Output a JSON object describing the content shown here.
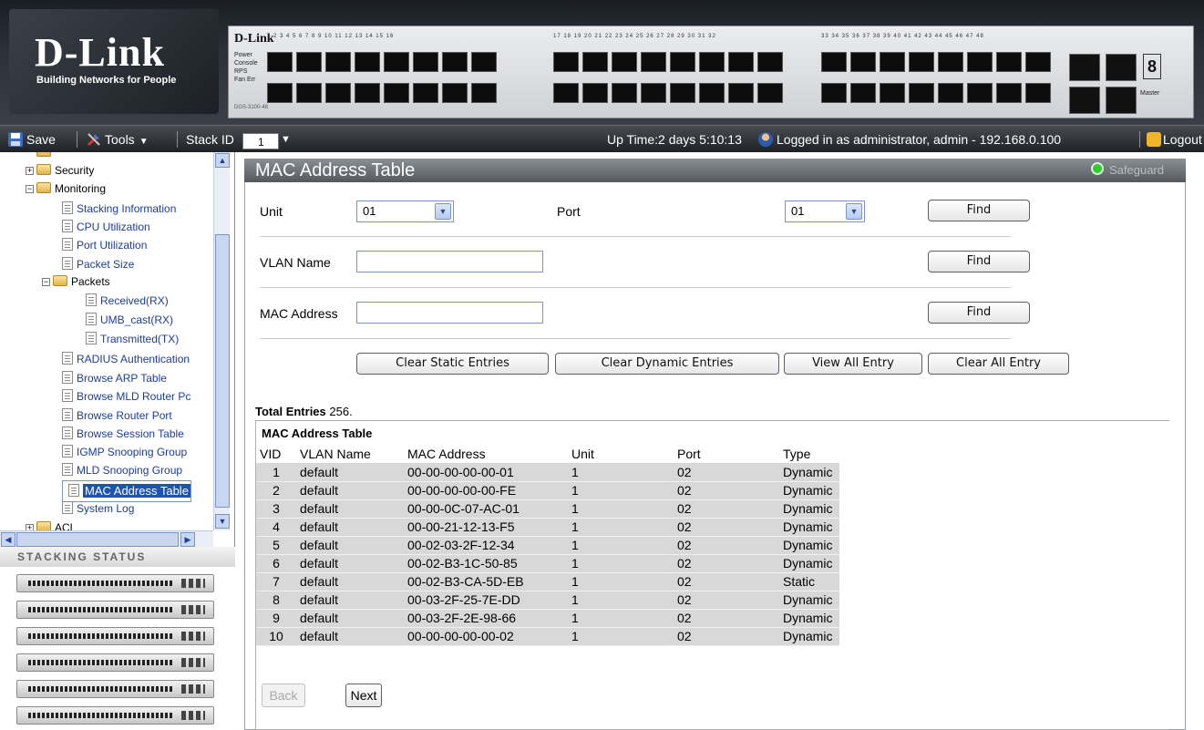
{
  "header": {
    "logo_main": "D-Link",
    "logo_sub": "Building Networks for People",
    "device_brand": "D-Link",
    "device_leds": [
      "Power",
      "Console",
      "RPS",
      "Fan Err"
    ],
    "device_model": "DGS-3100-48",
    "port_numbers": [
      "1 2 3 4 5 6 7 8 9 10 11 12 13 14 15 16",
      "17 18 19 20 21 22 23 24 25 26 27 28 29 30 31 32",
      "33 34 35 36 37 38 39 40 41 42 43 44 45 46 47 48"
    ],
    "seg_display": "8",
    "master_label": "Master"
  },
  "toolbar": {
    "save_label": "Save",
    "tools_label": "Tools",
    "stack_id_label": "Stack ID",
    "stack_id_value": "1",
    "uptime": "Up Time:2 days 5:10:13",
    "logged_in": "Logged in as administrator, admin - 192.168.0.100",
    "logout_label": "Logout"
  },
  "tree": {
    "items": [
      {
        "label": "Security",
        "type": "folder"
      },
      {
        "label": "Monitoring",
        "type": "folder"
      },
      {
        "label": "Stacking Information",
        "type": "page"
      },
      {
        "label": "CPU Utilization",
        "type": "page"
      },
      {
        "label": "Port Utilization",
        "type": "page"
      },
      {
        "label": "Packet Size",
        "type": "page"
      },
      {
        "label": "Packets",
        "type": "folder"
      },
      {
        "label": "Received(RX)",
        "type": "page"
      },
      {
        "label": "UMB_cast(RX)",
        "type": "page"
      },
      {
        "label": "Transmitted(TX)",
        "type": "page"
      },
      {
        "label": "RADIUS Authentication",
        "type": "page"
      },
      {
        "label": "Browse ARP Table",
        "type": "page"
      },
      {
        "label": "Browse MLD Router Pc",
        "type": "page"
      },
      {
        "label": "Browse Router Port",
        "type": "page"
      },
      {
        "label": "Browse Session Table",
        "type": "page"
      },
      {
        "label": "IGMP Snooping Group",
        "type": "page"
      },
      {
        "label": "MLD Snooping Group",
        "type": "page"
      },
      {
        "label": "MAC Address Table",
        "type": "page",
        "selected": true
      },
      {
        "label": "System Log",
        "type": "page"
      },
      {
        "label": "ACL",
        "type": "folder"
      }
    ]
  },
  "stacking": {
    "title": "STACKING STATUS",
    "unit_count": 6
  },
  "main": {
    "title": "MAC Address Table",
    "safeguard": "Safeguard",
    "unit_label": "Unit",
    "unit_value": "01",
    "port_label": "Port",
    "port_value": "01",
    "find_label": "Find",
    "vlan_label": "VLAN Name",
    "vlan_value": "",
    "mac_label": "MAC Address",
    "mac_value": "",
    "clear_static": "Clear Static Entries",
    "clear_dynamic": "Clear Dynamic Entries",
    "view_all": "View All Entry",
    "clear_all": "Clear All Entry",
    "total_label": "Total Entries",
    "total_value": "256.",
    "table_title": "MAC Address Table",
    "columns": [
      "VID",
      "VLAN Name",
      "MAC Address",
      "Unit",
      "Port",
      "Type"
    ],
    "rows": [
      [
        "1",
        "default",
        "00-00-00-00-00-01",
        "1",
        "02",
        "Dynamic"
      ],
      [
        "2",
        "default",
        "00-00-00-00-00-FE",
        "1",
        "02",
        "Dynamic"
      ],
      [
        "3",
        "default",
        "00-00-0C-07-AC-01",
        "1",
        "02",
        "Dynamic"
      ],
      [
        "4",
        "default",
        "00-00-21-12-13-F5",
        "1",
        "02",
        "Dynamic"
      ],
      [
        "5",
        "default",
        "00-02-03-2F-12-34",
        "1",
        "02",
        "Dynamic"
      ],
      [
        "6",
        "default",
        "00-02-B3-1C-50-85",
        "1",
        "02",
        "Dynamic"
      ],
      [
        "7",
        "default",
        "00-02-B3-CA-5D-EB",
        "1",
        "02",
        "Static"
      ],
      [
        "8",
        "default",
        "00-03-2F-25-7E-DD",
        "1",
        "02",
        "Dynamic"
      ],
      [
        "9",
        "default",
        "00-03-2F-2E-98-66",
        "1",
        "02",
        "Dynamic"
      ],
      [
        "10",
        "default",
        "00-00-00-00-00-02",
        "1",
        "02",
        "Dynamic"
      ]
    ],
    "back_label": "Back",
    "next_label": "Next"
  }
}
